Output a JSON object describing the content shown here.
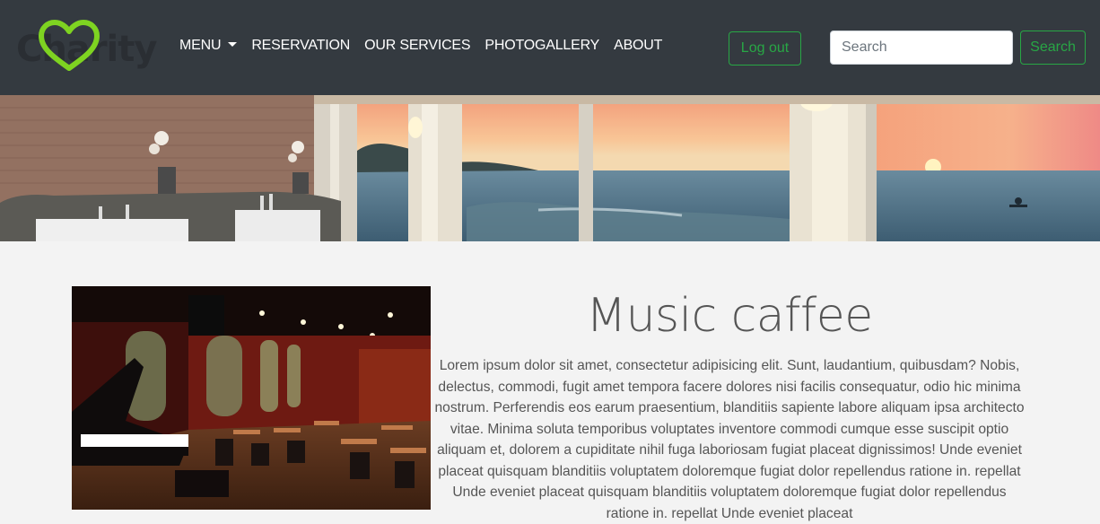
{
  "brand": {
    "logo_text": "Charity",
    "accent": "#28a745",
    "navbar_bg": "#343a40"
  },
  "nav": {
    "menu": "MENU",
    "reservation": "RESERVATION",
    "services": "OUR SERVICES",
    "gallery": "PHOTOGALLERY",
    "about": "ABOUT"
  },
  "auth": {
    "logout": "Log out"
  },
  "search": {
    "placeholder": "Search",
    "button": "Search"
  },
  "main": {
    "title": "Music caffee",
    "text": "Lorem ipsum dolor sit amet, consectetur adipisicing elit. Sunt, laudantium, quibusdam? Nobis, delectus, commodi, fugit amet tempora facere dolores nisi facilis consequatur, odio hic minima nostrum. Perferendis eos earum praesentium, blanditiis sapiente labore aliquam ipsa architecto vitae. Minima soluta temporibus voluptates inventore commodi cumque esse suscipit optio aliquam et, dolorem a cupiditate nihil fuga laboriosam fugiat placeat dignissimos! Unde eveniet placeat quisquam blanditiis voluptatem doloremque fugiat dolor repellendus ratione in. repellat Unde eveniet placeat quisquam blanditiis voluptatem doloremque fugiat dolor repellendus ratione in. repellat Unde eveniet placeat"
  }
}
